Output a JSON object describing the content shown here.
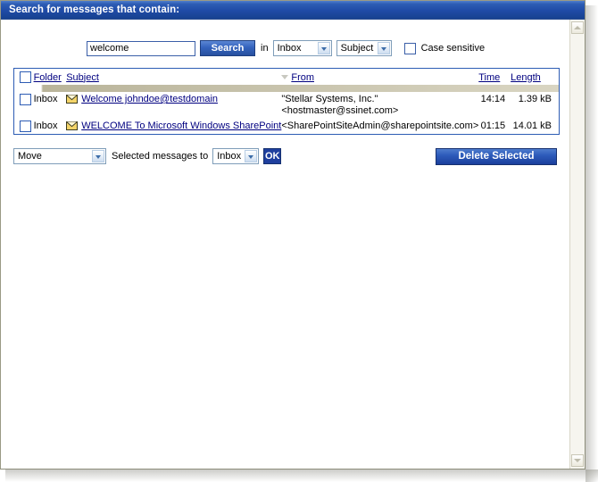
{
  "window": {
    "title": "Search for messages that contain:"
  },
  "search": {
    "query_value": "welcome",
    "search_button": "Search",
    "in_label": "in",
    "folder_select": "Inbox",
    "field_select": "Subject",
    "case_sensitive_label": "Case sensitive",
    "case_sensitive_checked": false
  },
  "table": {
    "columns": {
      "folder": "Folder",
      "subject": "Subject",
      "from": "From",
      "time": "Time",
      "length": "Length"
    },
    "sorted_by": "From",
    "rows": [
      {
        "checked": false,
        "folder": "Inbox",
        "icon": "envelope-icon",
        "subject": "Welcome johndoe@testdomain",
        "from_line1": "\"Stellar Systems, Inc.\"",
        "from_line2": "<hostmaster@ssinet.com>",
        "time": "14:14",
        "length": "1.39 kB"
      },
      {
        "checked": false,
        "folder": "Inbox",
        "icon": "envelope-icon",
        "subject": "WELCOME To Microsoft Windows SharePoint",
        "from_line1": "<SharePointSiteAdmin@sharepointsite.com>",
        "from_line2": "",
        "time": "01:15",
        "length": "14.01 kB"
      }
    ]
  },
  "actions": {
    "action_select": "Move",
    "middle_text": "Selected messages to",
    "target_select": "Inbox",
    "ok_button": "OK",
    "delete_button": "Delete Selected"
  },
  "scrollbar": {
    "up_icon": "chevron-up-icon",
    "down_icon": "chevron-down-icon"
  },
  "colors": {
    "title_bar": "#1f4ba6",
    "accent_blue": "#2d5cb4",
    "link": "#000080",
    "header_rule": "#b9b49a"
  }
}
